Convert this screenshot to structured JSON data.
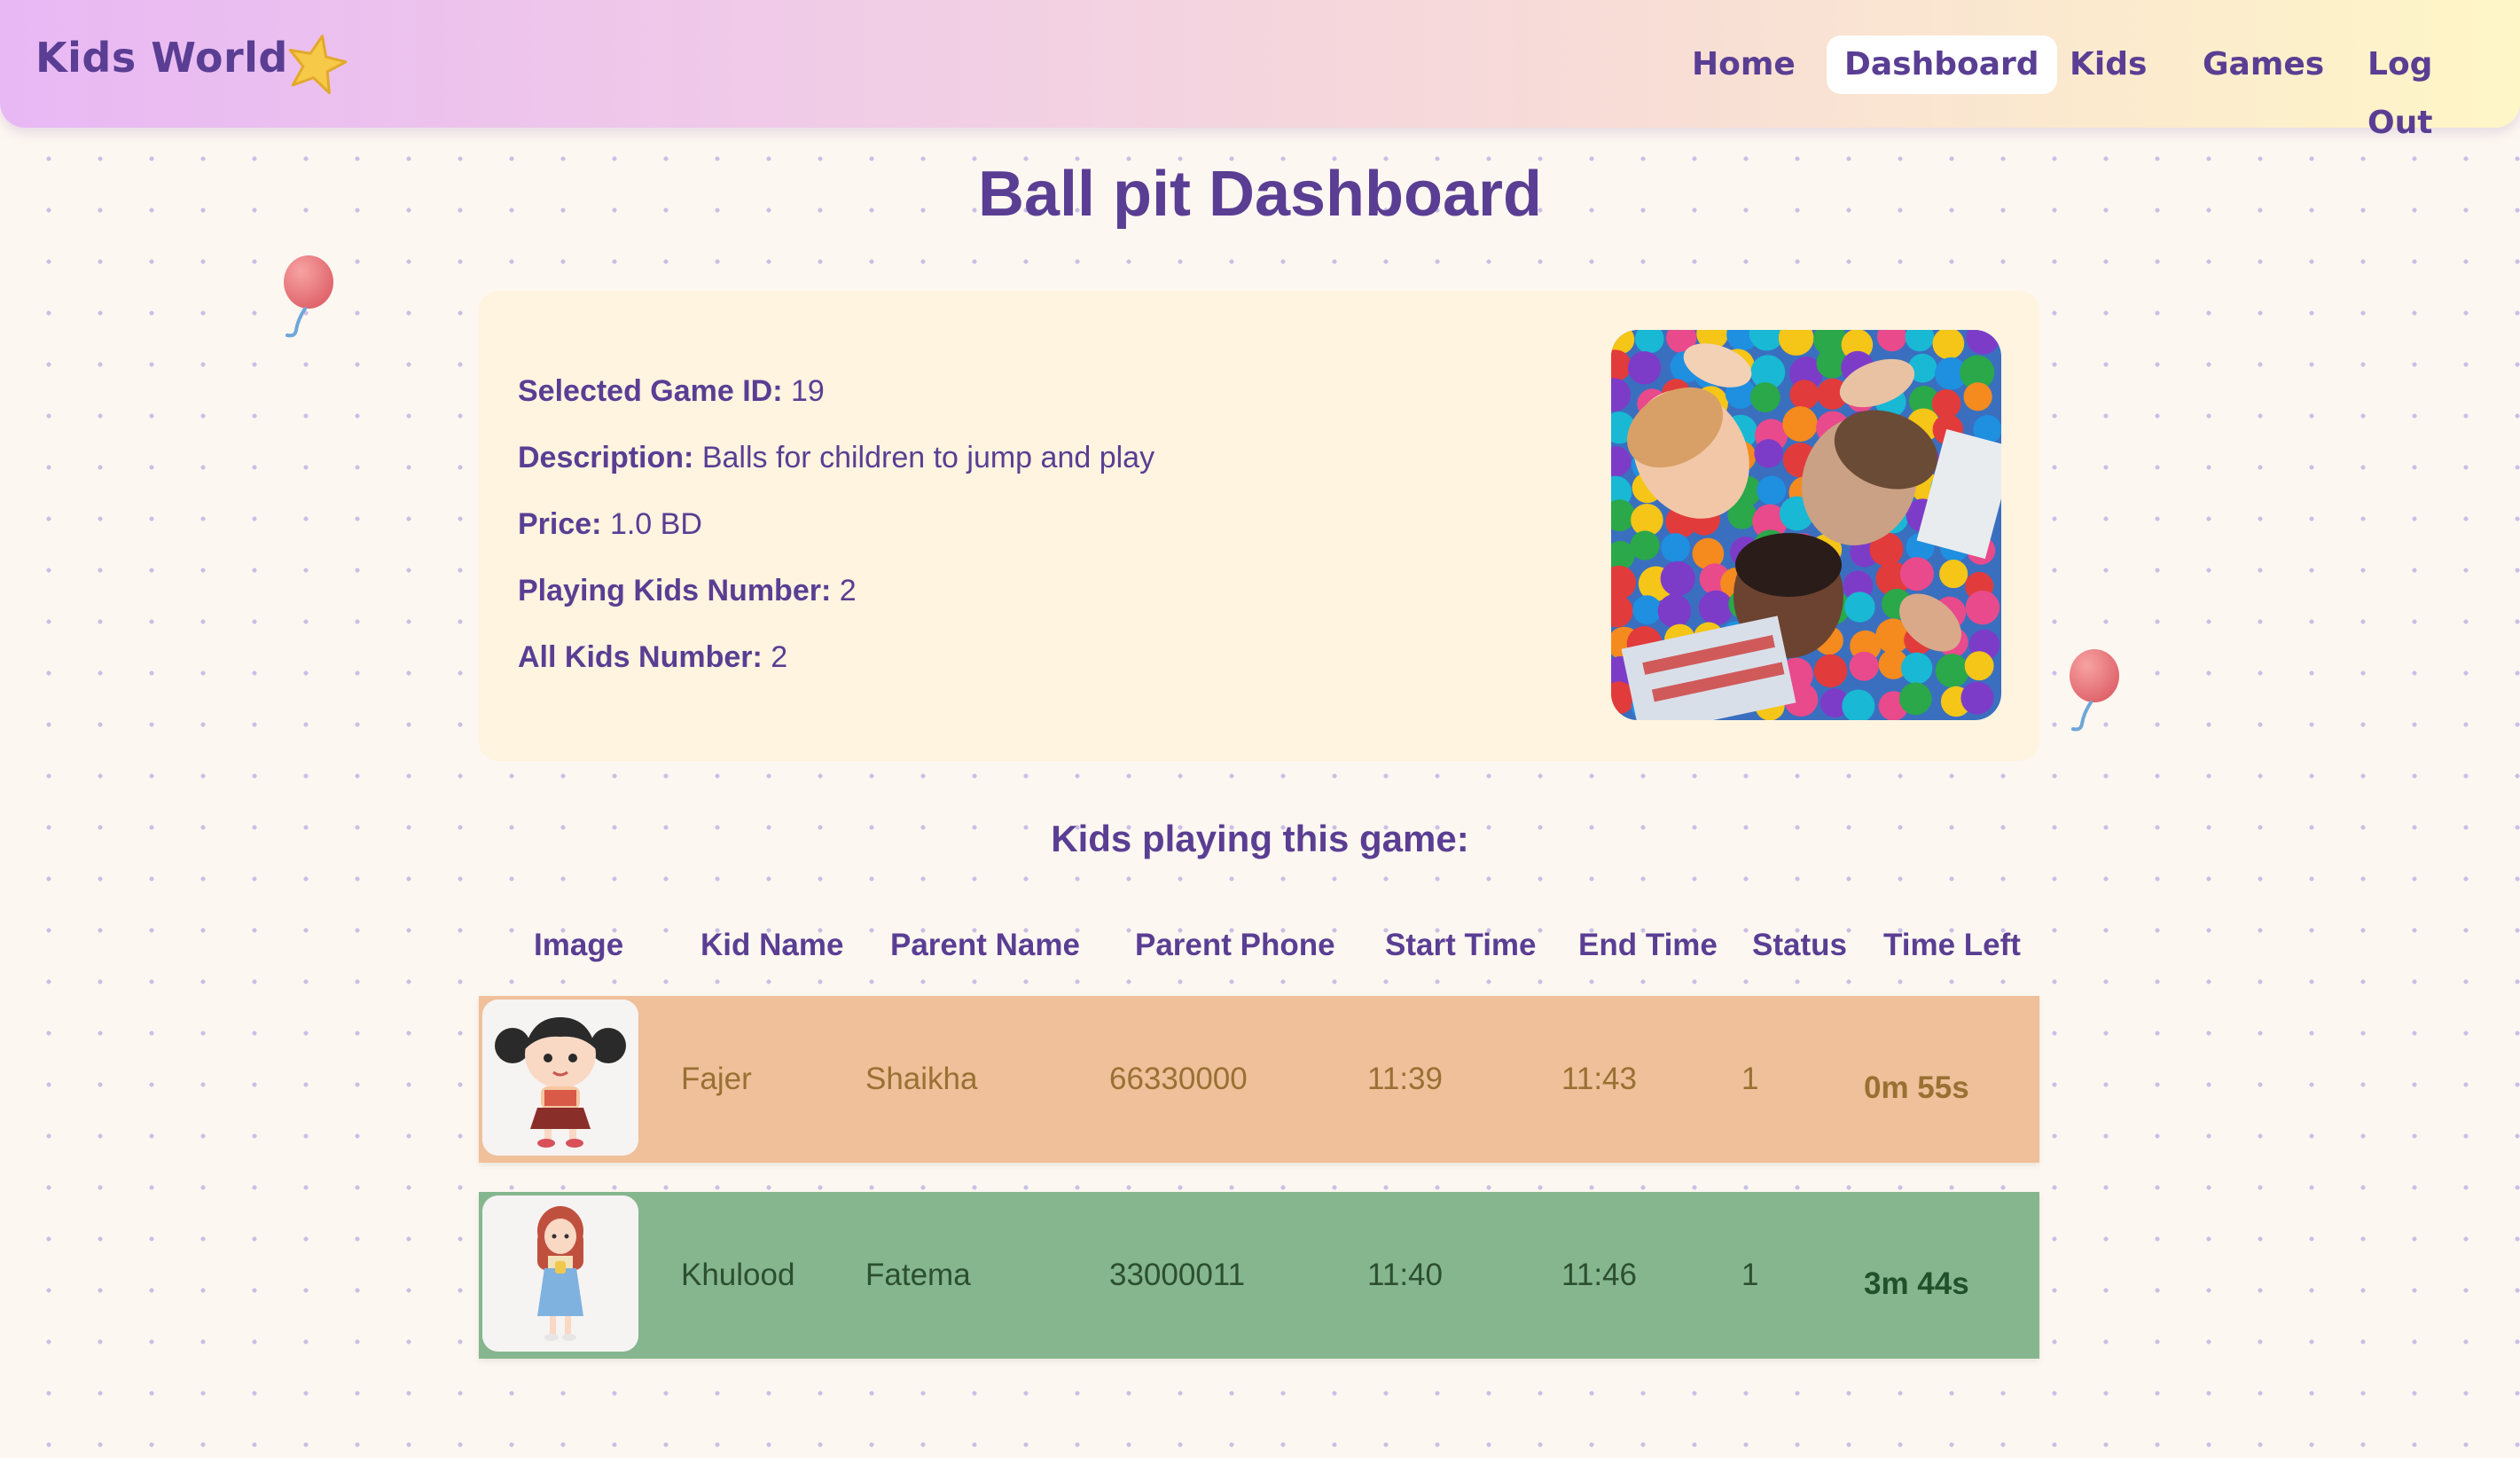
{
  "nav": {
    "brand": "Kids World",
    "links": [
      "Home",
      "Dashboard",
      "Kids",
      "Games",
      "Log Out"
    ],
    "active": "Dashboard"
  },
  "page": {
    "title": "Ball pit Dashboard"
  },
  "game": {
    "id_label": "Selected Game ID:",
    "id": "19",
    "description_label": "Description:",
    "description": "Balls for children to jump and play",
    "price_label": "Price:",
    "price": "1.0 BD",
    "playing_label": "Playing Kids Number:",
    "playing": "2",
    "all_label": "All Kids Number:",
    "all": "2"
  },
  "kids_section": {
    "heading": "Kids playing this game:",
    "columns": [
      "Image",
      "Kid Name",
      "Parent Name",
      "Parent Phone",
      "Start Time",
      "End Time",
      "Status",
      "Time Left"
    ],
    "rows": [
      {
        "kid_name": "Fajer",
        "parent_name": "Shaikha",
        "parent_phone": "66330000",
        "start_time": "11:39",
        "end_time": "11:43",
        "status": "1",
        "time_left": "0m 55s",
        "bg_color": "#efc099",
        "text_color": "#9a7033",
        "time_left_color": "#9a7033"
      },
      {
        "kid_name": "Khulood",
        "parent_name": "Fatema",
        "parent_phone": "33000011",
        "start_time": "11:40",
        "end_time": "11:46",
        "status": "1",
        "time_left": "3m 44s",
        "bg_color": "#85b68e",
        "text_color": "#2c4f30",
        "time_left_color": "#22502a"
      }
    ]
  },
  "colors": {
    "primary_text": "#5a3e93",
    "card_bg": "#fef4e0",
    "page_bg": "#fdf7f1"
  }
}
